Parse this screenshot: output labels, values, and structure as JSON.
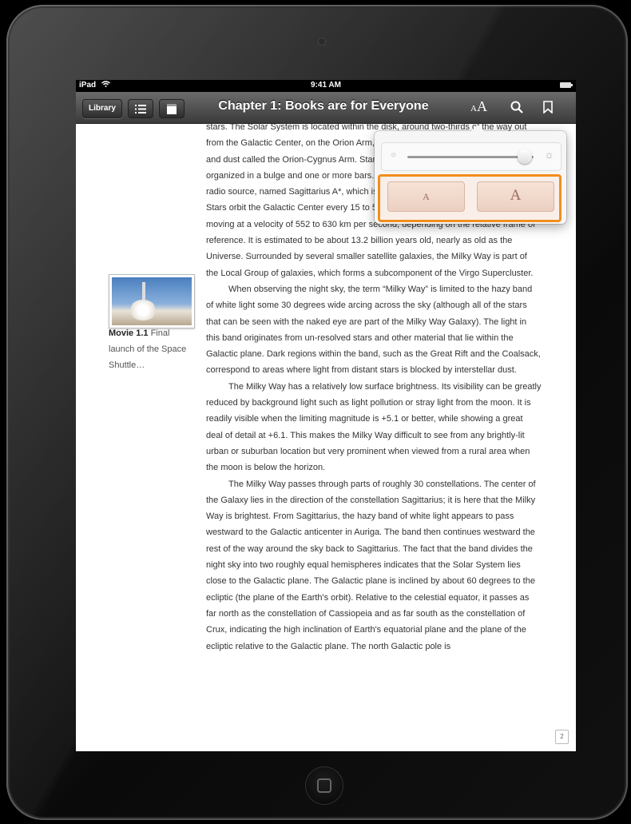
{
  "status_bar": {
    "device": "iPad",
    "time": "9:41 AM"
  },
  "toolbar": {
    "library_label": "Library",
    "title": "Chapter 1: Books are for Everyone",
    "font_small_a": "A",
    "font_large_a": "A"
  },
  "popover": {
    "brightness_level": 0.93,
    "smaller_label": "A",
    "larger_label": "A",
    "accent_color": "#f28e1c"
  },
  "media": {
    "caption_title": "Movie 1.1",
    "caption_text": " Final launch of the Space Shuttle…"
  },
  "body": {
    "p1": "stars. The Solar System is located within the disk, around two-thirds of the way out from the Galactic Center, on the Orion Arm, a partial spiral arm concentration of gas and dust called the Orion-Cygnus Arm. Stars in the inner 10,000 light-years are organized in a bulge and one or more bars. The very center is marked by an intense radio source, named Sagittarius A*, which is likely to be a supermassive black hole. Stars orbit the Galactic Center every 15 to 50 million years. The Galaxy as a whole is moving at a velocity of 552 to 630 km per second, depending on the relative frame of reference. It is estimated to be about 13.2 billion years old, nearly as old as the Universe. Surrounded by several smaller satellite galaxies, the Milky Way is part of the Local Group of galaxies, which forms a subcomponent of the Virgo Supercluster.",
    "p2": "When observing the night sky, the term “Milky Way” is limited to the hazy band of white light some 30 degrees wide arcing across the sky (although all of the stars that can be seen with the naked eye are part of the Milky Way Galaxy). The light in this band originates from un-resolved stars and other material that lie within the Galactic plane. Dark regions within the band, such as the Great Rift and the Coalsack, correspond to areas where light from distant stars is blocked by interstellar dust.",
    "p3": "The Milky Way has a relatively low surface brightness. Its visibility can be greatly reduced by background light such as light pollution or stray light from the moon. It is readily visible when the limiting magnitude is +5.1 or better, while showing a great deal of detail at +6.1. This makes the Milky Way difficult to see from any brightly-lit urban or suburban location but very prominent when viewed from a rural area when the moon is below the horizon.",
    "p4": "The Milky Way passes through parts of roughly 30 constellations. The center of the Galaxy lies in the direction of the constellation Sagittarius; it is here that the Milky Way is brightest. From Sagittarius, the hazy band of white light appears to pass westward to the Galactic anticenter in Auriga. The band then continues westward the rest of the way around the sky back to Sagittarius. The fact that the band divides the night sky into two roughly equal hemispheres indicates that the Solar System lies close to the Galactic plane. The Galactic plane is inclined by about 60 degrees to the ecliptic (the plane of the Earth's orbit). Relative to the celestial equator, it passes as far north as the constellation of Cassiopeia and as far south as the constellation of Crux, indicating the high inclination of Earth's equatorial plane and the plane of the ecliptic relative to the Galactic plane. The north Galactic pole is",
    "page_number": "2"
  }
}
